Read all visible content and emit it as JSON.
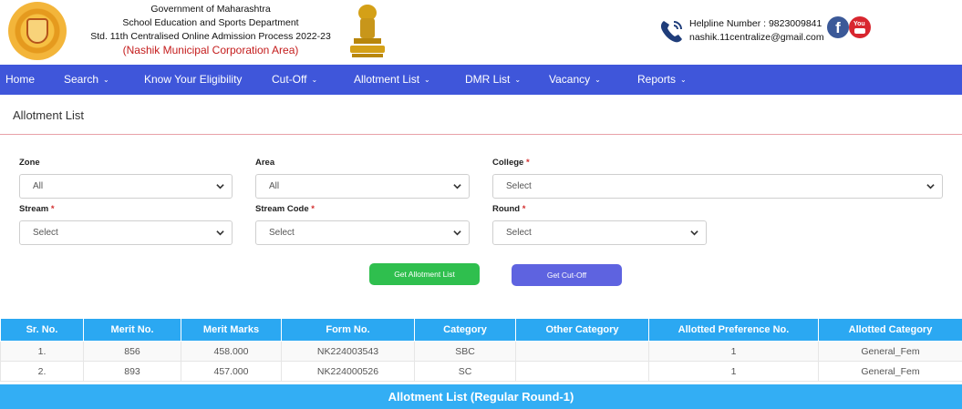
{
  "header": {
    "line1": "Government of Maharashtra",
    "line2": "School Education and Sports Department",
    "line3": "Std. 11th Centralised Online Admission Process 2022-23",
    "line4_open": "(",
    "line4_highlight": "Nashik Municipal Corporation Area",
    "line4_close": ")",
    "helpline": "Helpline Number : 9823009841",
    "email": "nashik.11centralize@gmail.com",
    "youtube_text": "You"
  },
  "nav": {
    "items": [
      {
        "label": "Home",
        "dropdown": false
      },
      {
        "label": "Search",
        "dropdown": true
      },
      {
        "label": "Know Your Eligibility",
        "dropdown": false
      },
      {
        "label": "Cut-Off",
        "dropdown": true
      },
      {
        "label": "Allotment List",
        "dropdown": true
      },
      {
        "label": "DMR List",
        "dropdown": true
      },
      {
        "label": "Vacancy",
        "dropdown": true
      },
      {
        "label": "Reports",
        "dropdown": true
      }
    ],
    "chevron": "⌄"
  },
  "page_title": "Allotment List",
  "form": {
    "zone_label": "Zone",
    "zone_value": "All",
    "area_label": "Area",
    "area_value": "All",
    "college_label": "College",
    "college_value": "Select",
    "stream_label": "Stream",
    "stream_value": "Select",
    "stream_code_label": "Stream Code",
    "stream_code_value": "Select",
    "round_label": "Round",
    "round_value": "Select",
    "required_mark": "*",
    "get_allotment_btn": "Get Allotment List",
    "get_cutoff_btn": "Get Cut-Off"
  },
  "table": {
    "headers": [
      "Sr. No.",
      "Merit No.",
      "Merit Marks",
      "Form No.",
      "Category",
      "Other Category",
      "Allotted Preference No.",
      "Allotted Category"
    ],
    "rows": [
      [
        "1.",
        "856",
        "458.000",
        "NK224003543",
        "SBC",
        "",
        "1",
        "General_Fem"
      ],
      [
        "2.",
        "893",
        "457.000",
        "NK224000526",
        "SC",
        "",
        "1",
        "General_Fem"
      ]
    ]
  },
  "banner": "Allotment List (Regular Round-1)",
  "colors": {
    "nav_bg": "#3f56da",
    "table_header": "#2ba8f2",
    "banner": "#33aef4",
    "btn_green": "#2fbf4e",
    "btn_purple": "#5e63e0",
    "highlight_red": "#c41c1c"
  }
}
